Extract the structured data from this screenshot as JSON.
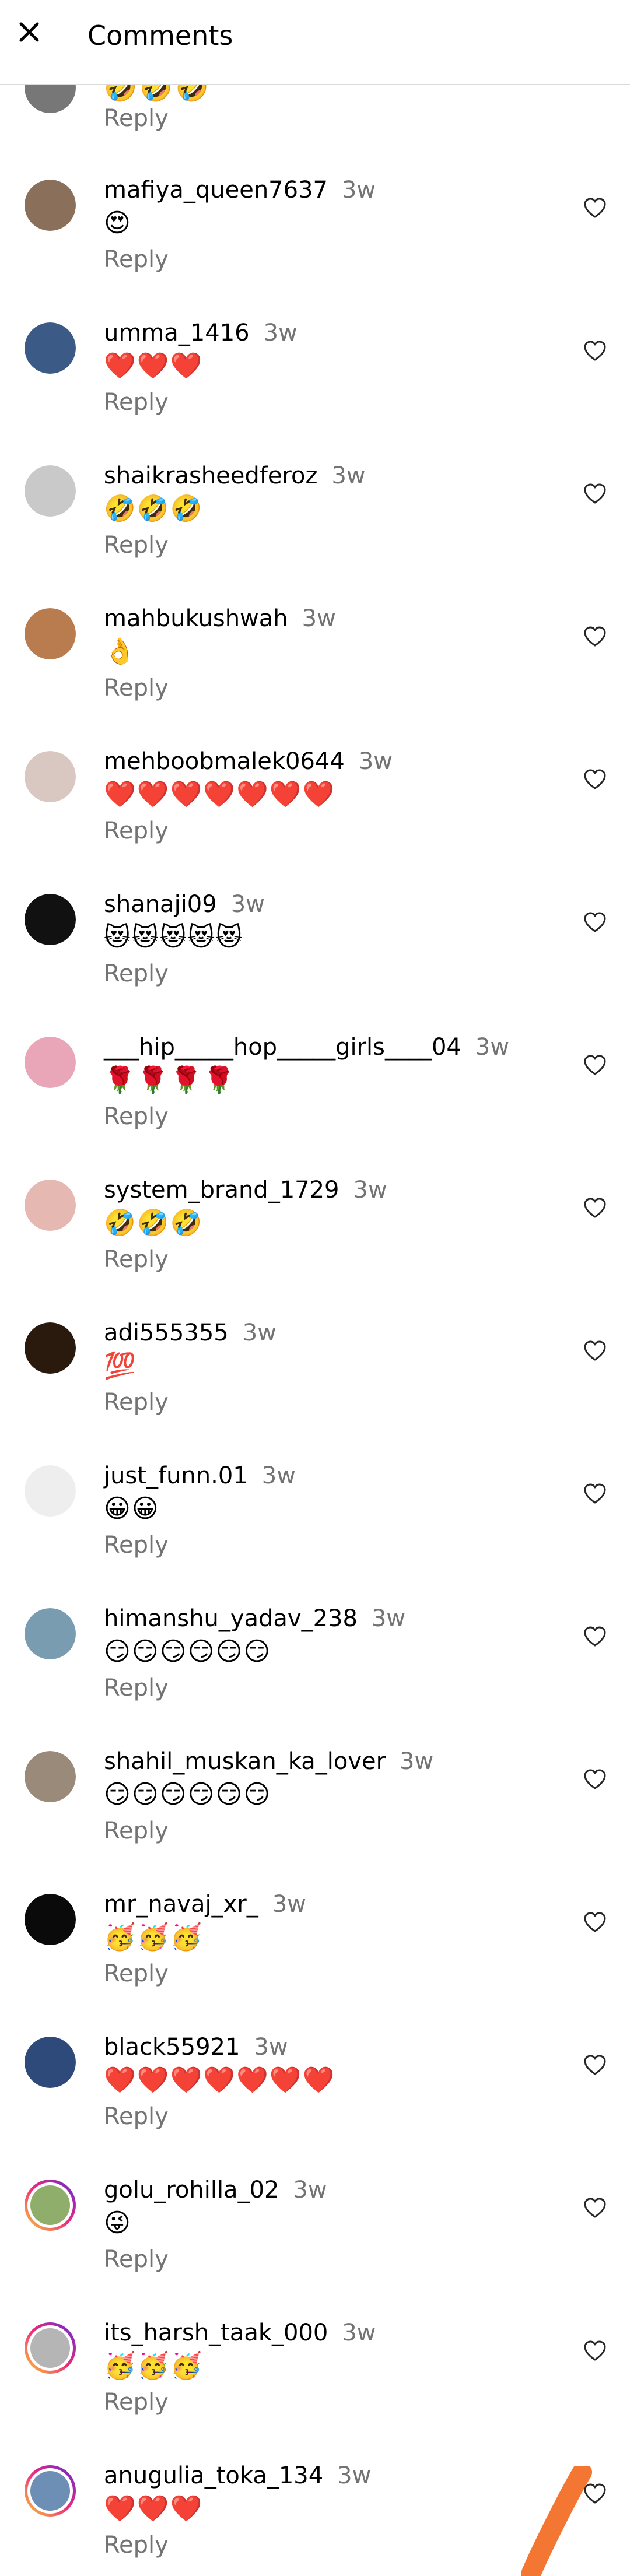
{
  "header": {
    "title": "Comments",
    "close_icon": "close-icon"
  },
  "partial_top": {
    "emojis": "🤣🤣🤣",
    "reply_label": "Reply"
  },
  "reply_label": "Reply",
  "comments": [
    {
      "username": "mafiya_queen7637",
      "time": "3w",
      "text": "😍",
      "avatar_color": "#8a6f5a"
    },
    {
      "username": "umma_1416",
      "time": "3w",
      "text": "❤️❤️❤️",
      "avatar_color": "#3b5b86"
    },
    {
      "username": "shaikrasheedferoz",
      "time": "3w",
      "text": "🤣🤣🤣",
      "avatar_color": "#c9c9c9"
    },
    {
      "username": "mahbukushwah",
      "time": "3w",
      "text": "👌",
      "avatar_color": "#b97c4f"
    },
    {
      "username": "mehboobmalek0644",
      "time": "3w",
      "text": "❤️❤️❤️❤️❤️❤️❤️",
      "avatar_color": "#d9c7c2"
    },
    {
      "username": "shanaji09",
      "time": "3w",
      "text": "😻😻😻😻😻",
      "avatar_color": "#111111"
    },
    {
      "username": "___hip_____hop_____girls____04",
      "time": "3w",
      "text": "🌹🌹🌹🌹",
      "avatar_color": "#e8a6b8"
    },
    {
      "username": "system_brand_1729",
      "time": "3w",
      "text": "🤣🤣🤣",
      "avatar_color": "#e5b9b2"
    },
    {
      "username": "adi555355",
      "time": "3w",
      "text": "💯",
      "avatar_color": "#2a1a0e"
    },
    {
      "username": "just_funn.01",
      "time": "3w",
      "text": "😀😀",
      "avatar_color": "#eeeeee"
    },
    {
      "username": "himanshu_yadav_238",
      "time": "3w",
      "text": "😏😏😏😏😏😏",
      "avatar_color": "#7a9cb0"
    },
    {
      "username": "shahil_muskan_ka_lover",
      "time": "3w",
      "text": "😏😏😏😏😏😏",
      "avatar_color": "#9a8a7a"
    },
    {
      "username": "mr_navaj_xr_",
      "time": "3w",
      "text": "🥳🥳🥳",
      "avatar_color": "#0a0a0a"
    },
    {
      "username": "black55921",
      "time": "3w",
      "text": "❤️❤️❤️❤️❤️❤️❤️",
      "avatar_color": "#2d4a7a"
    },
    {
      "username": "golu_rohilla_02",
      "time": "3w",
      "text": "😜",
      "avatar_color": "#8fae6b",
      "story_ring": true
    },
    {
      "username": "its_harsh_taak_000",
      "time": "3w",
      "text": "🥳🥳🥳",
      "avatar_color": "#b5b5b5",
      "story_ring": true
    },
    {
      "username": "anugulia_toka_134",
      "time": "3w",
      "text": "❤️❤️❤️",
      "avatar_color": "#6e8fb5",
      "story_ring": true
    }
  ],
  "colors": {
    "secondary_text": "#737373",
    "divider": "#dbdbdb",
    "annotation_stroke": "#f26a21"
  },
  "icons": {
    "like": "heart-outline-icon"
  }
}
